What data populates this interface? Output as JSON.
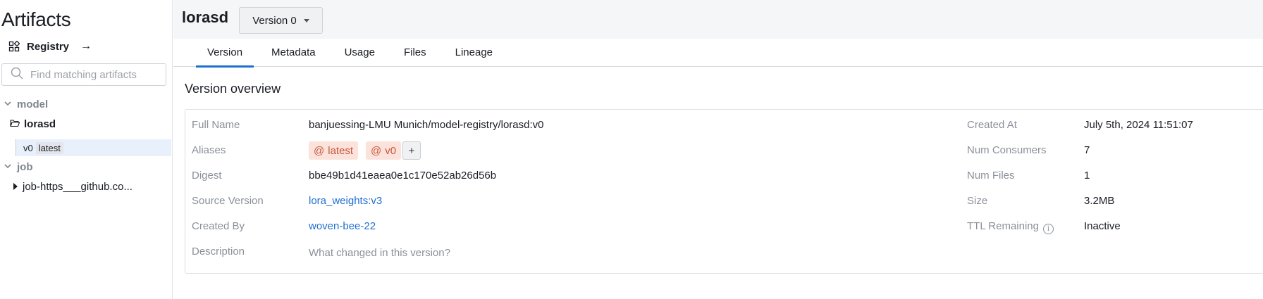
{
  "sidebar": {
    "title": "Artifacts",
    "registry_label": "Registry",
    "registry_arrow": "→",
    "search_placeholder": "Find matching artifacts",
    "groups": [
      {
        "name": "model"
      },
      {
        "name": "job"
      }
    ],
    "selected_artifact": "lorasd",
    "folder_icon": "📂",
    "version_label": "v0",
    "version_alias": "latest",
    "job_item": "job-https___github.co..."
  },
  "header": {
    "artifact_name": "lorasd",
    "version_dropdown": "Version 0"
  },
  "tabs": [
    "Version",
    "Metadata",
    "Usage",
    "Files",
    "Lineage"
  ],
  "active_tab": "Version",
  "overview": {
    "title": "Version overview",
    "labels": {
      "full_name": "Full Name",
      "aliases": "Aliases",
      "digest": "Digest",
      "source_version": "Source Version",
      "created_by": "Created By",
      "description": "Description",
      "created_at": "Created At",
      "num_consumers": "Num Consumers",
      "num_files": "Num Files",
      "size": "Size",
      "ttl_remaining": "TTL Remaining"
    },
    "values": {
      "full_name": "banjuessing-LMU Munich/model-registry/lorasd:v0",
      "aliases": [
        "latest",
        "v0"
      ],
      "alias_add": "+",
      "digest": "bbe49b1d41eaea0e1c170e52ab26d56b",
      "source_version": "lora_weights:v3",
      "created_by": "woven-bee-22",
      "description_placeholder": "What changed in this version?",
      "created_at": "July 5th, 2024 11:51:07",
      "num_consumers": "7",
      "num_files": "1",
      "size": "3.2MB",
      "ttl_remaining": "Inactive"
    }
  },
  "colors": {
    "accent": "#1f6fd0",
    "alias_bg": "#fbe3dc",
    "alias_text": "#c9563b",
    "selected_row": "#e8f1fb"
  }
}
